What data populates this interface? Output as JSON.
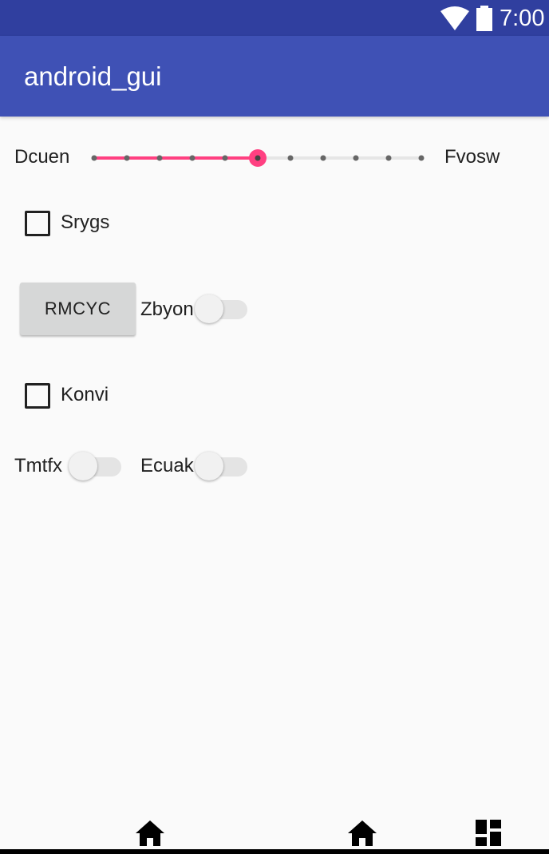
{
  "status_bar": {
    "time": "7:00",
    "icons": [
      "wifi-icon",
      "battery-icon"
    ]
  },
  "app_bar": {
    "title": "android_gui"
  },
  "seekbar": {
    "left_label": "Dcuen",
    "right_label": "Fvosw",
    "ticks": 11,
    "value_index": 5,
    "accent_color": "#ff4081"
  },
  "checkbox_1": {
    "label": "Srygs",
    "checked": false
  },
  "button_1": {
    "label": "RMCYC"
  },
  "switch_1": {
    "label": "Zbyon",
    "on": false
  },
  "checkbox_2": {
    "label": "Konvi",
    "checked": false
  },
  "switch_2": {
    "label": "Tmtfx",
    "on": false
  },
  "switch_3": {
    "label": "Ecuak",
    "on": false
  },
  "nav_bar": {
    "icons": [
      "home-icon",
      "home-icon",
      "dashboard-icon"
    ]
  },
  "colors": {
    "primary": "#3f51b5",
    "primary_dark": "#303f9f",
    "accent": "#ff4081"
  }
}
